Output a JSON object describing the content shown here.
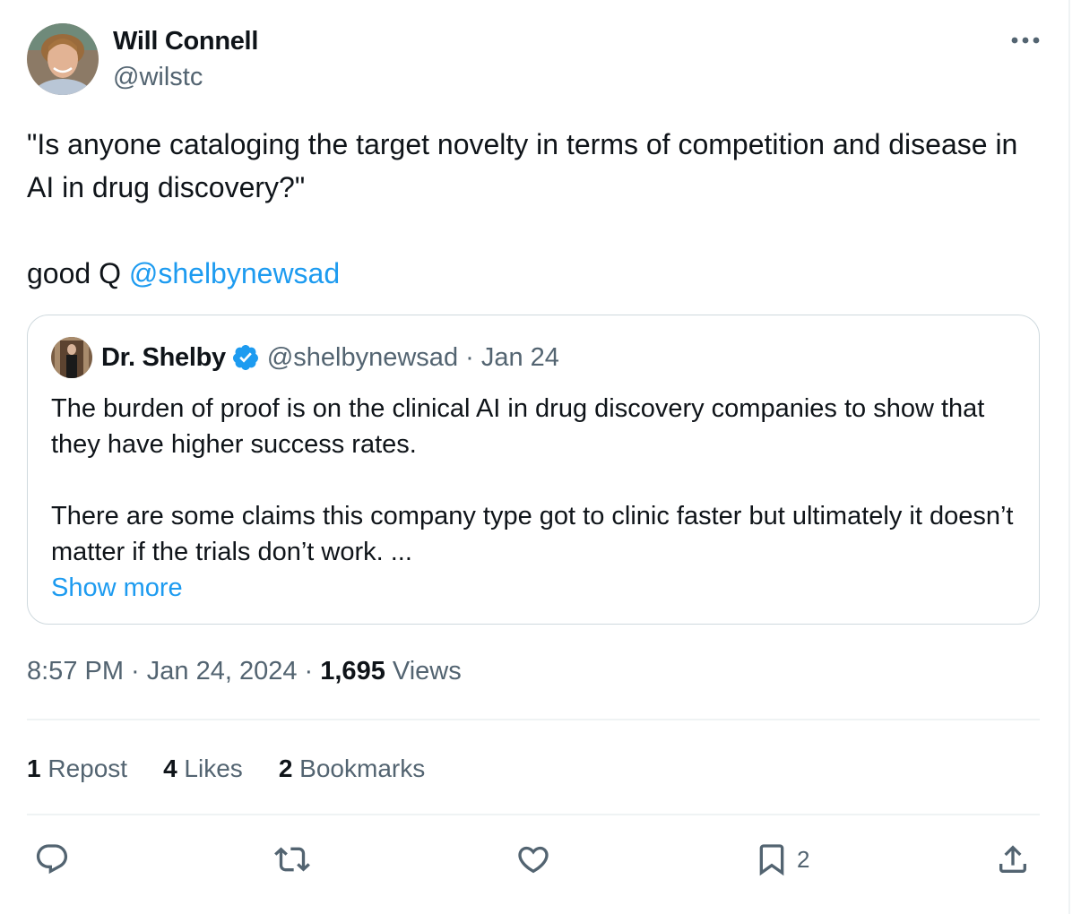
{
  "author": {
    "name": "Will Connell",
    "handle": "@wilstc"
  },
  "tweet": {
    "line1": "\"Is anyone cataloging the target novelty in terms of competition and disease in AI in drug discovery?\"",
    "line2_prefix": "good Q ",
    "mention": "@shelbynewsad"
  },
  "quoted": {
    "name": "Dr. Shelby",
    "meta": "@shelbynewsad · Jan 24",
    "para1": "The burden of proof is on the clinical AI in drug discovery companies to show that they have higher success rates.",
    "para2": "There are some claims this company type got to clinic faster but ultimately it doesn’t matter if the trials don’t work. ...",
    "show_more": "Show more"
  },
  "timestamp": {
    "text": "8:57 PM · Jan 24, 2024 · ",
    "views_count": "1,695",
    "views_label": " Views"
  },
  "stats": {
    "reposts_count": "1",
    "reposts_label": " Repost",
    "likes_count": "4",
    "likes_label": " Likes",
    "bookmarks_count": "2",
    "bookmarks_label": " Bookmarks"
  },
  "actions": {
    "icons": [
      "reply-icon",
      "repost-icon",
      "like-icon",
      "bookmark-icon",
      "share-icon"
    ],
    "bookmark_count": "2"
  },
  "colors": {
    "text": "#0f1419",
    "secondary": "#536471",
    "link": "#1d9bf0",
    "border": "#cfd9de"
  }
}
